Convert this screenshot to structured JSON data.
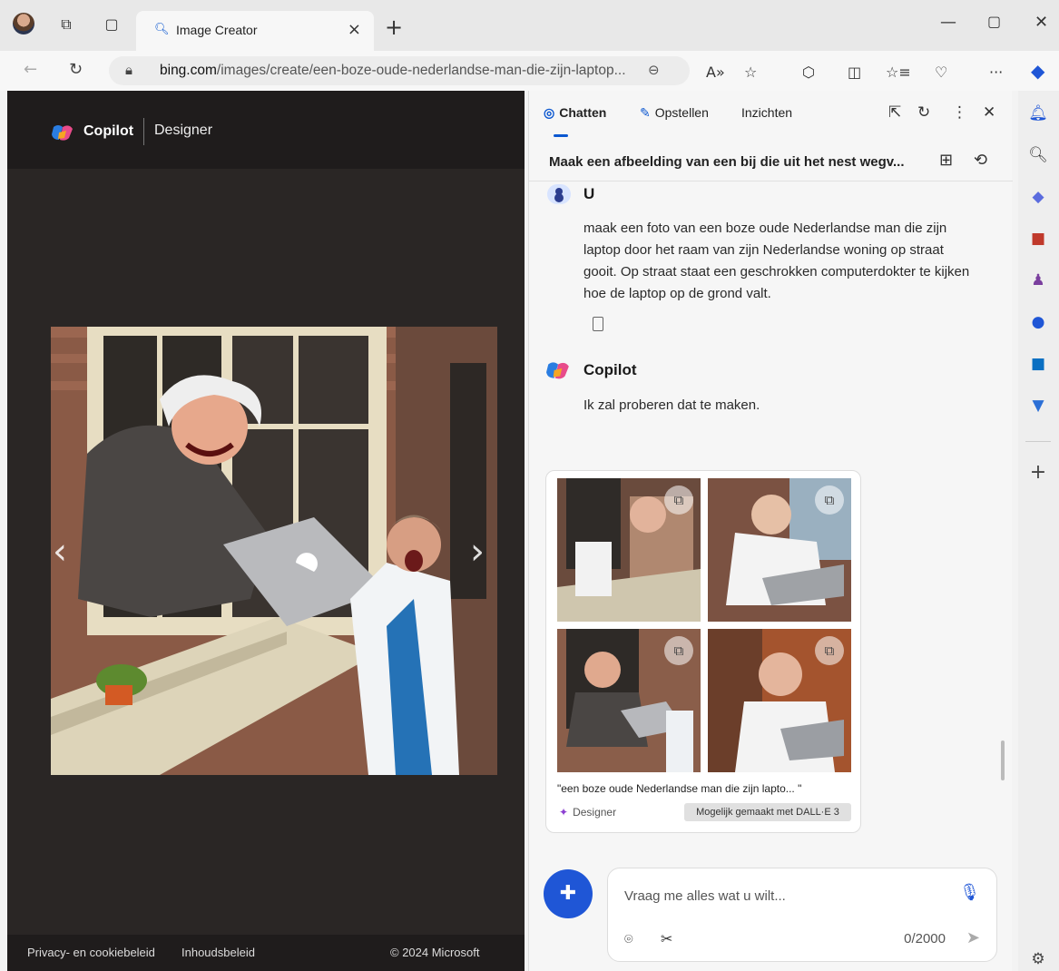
{
  "browser": {
    "tab_title": "Image Creator",
    "url_domain": "bing.com",
    "url_path": "/images/create/een-boze-oude-nederlandse-man-die-zijn-laptop..."
  },
  "left": {
    "brand": "Copilot",
    "brand_sub": "Designer",
    "footer": {
      "privacy": "Privacy- en cookiebeleid",
      "content_policy": "Inhoudsbeleid",
      "copyright": "© 2024 Microsoft"
    }
  },
  "sidebar": {
    "tabs": [
      "Chatten",
      "Opstellen",
      "Inzichten"
    ],
    "conversation_title": "Maak een afbeelding van een bij die uit het nest wegv...",
    "user_name": "U",
    "user_message": "maak een foto van een boze oude Nederlandse man die zijn laptop door het raam van zijn Nederlandse woning op straat gooit. Op straat staat een geschrokken computerdokter te kijken hoe de laptop op de grond valt.",
    "copilot_name": "Copilot",
    "copilot_message": "Ik zal proberen dat te maken.",
    "card": {
      "caption": "\"een boze oude Nederlandse man die zijn lapto... \"",
      "source": "Designer",
      "badge": "Mogelijk gemaakt met DALL·E 3"
    },
    "input": {
      "placeholder": "Vraag me alles wat u wilt...",
      "counter": "0/2000"
    }
  },
  "colors": {
    "accent": "#1f56d6",
    "dark_bg": "#2a2625"
  }
}
